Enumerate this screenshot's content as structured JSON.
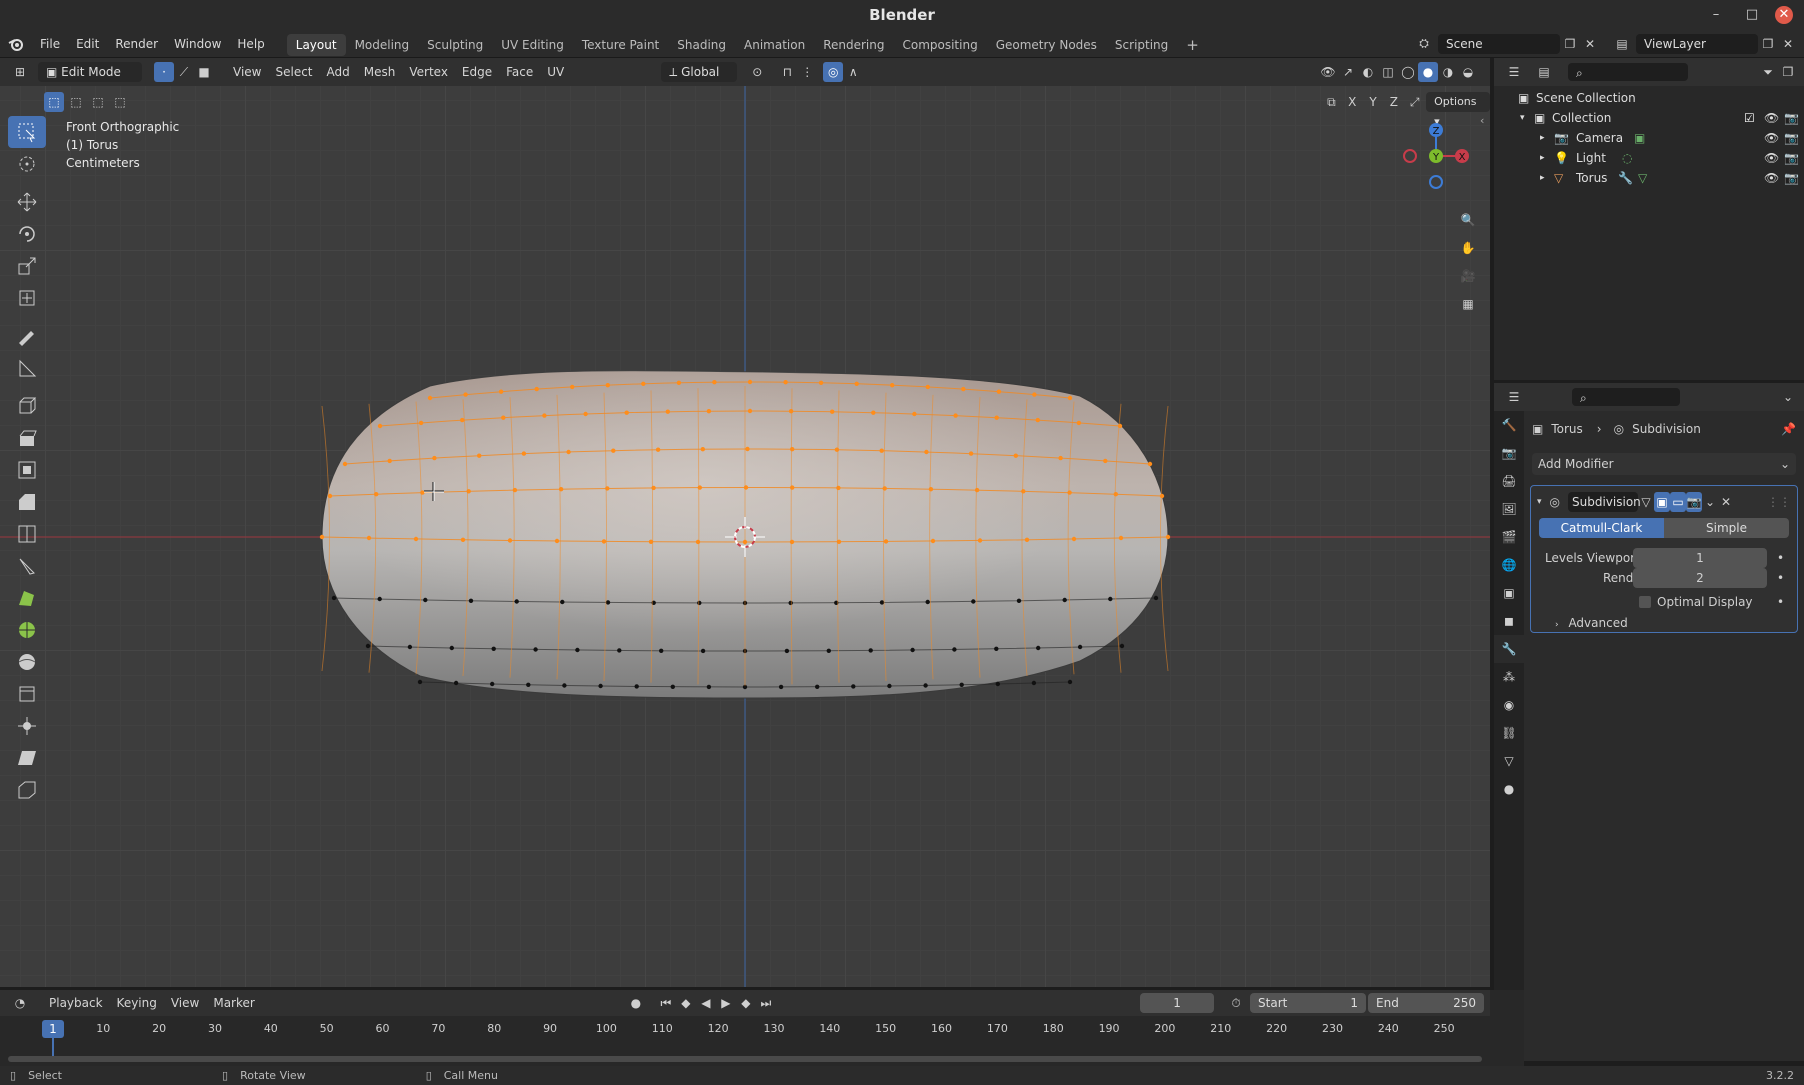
{
  "window": {
    "title": "Blender",
    "minimize": "–",
    "maximize": "□",
    "close": "✕"
  },
  "menubar": {
    "items": [
      "File",
      "Edit",
      "Render",
      "Window",
      "Help"
    ],
    "workspaces": [
      "Layout",
      "Modeling",
      "Sculpting",
      "UV Editing",
      "Texture Paint",
      "Shading",
      "Animation",
      "Rendering",
      "Compositing",
      "Geometry Nodes",
      "Scripting"
    ],
    "active_workspace": "Layout",
    "add_tab": "+",
    "scene": "Scene",
    "view_layer": "ViewLayer"
  },
  "viewport_header": {
    "mode": "Edit Mode",
    "menus": [
      "View",
      "Select",
      "Add",
      "Mesh",
      "Vertex",
      "Edge",
      "Face",
      "UV"
    ],
    "transform_orientation": "Global",
    "options": "Options",
    "axes": [
      "X",
      "Y",
      "Z"
    ]
  },
  "viewport": {
    "view_name": "Front Orthographic",
    "object_label": "(1) Torus",
    "units": "Centimeters",
    "gizmo": {
      "z": "Z",
      "y": "Y",
      "x": "X"
    }
  },
  "outliner": {
    "scene_collection": "Scene Collection",
    "collection": "Collection",
    "items": [
      "Camera",
      "Light",
      "Torus"
    ]
  },
  "properties": {
    "breadcrumb_object": "Torus",
    "breadcrumb_modifier": "Subdivision",
    "add_modifier": "Add Modifier",
    "modifier_name": "Subdivision",
    "type_catmull": "Catmull-Clark",
    "type_simple": "Simple",
    "levels_viewport_label": "Levels Viewport",
    "levels_viewport_value": "1",
    "render_label": "Render",
    "render_value": "2",
    "optimal_display": "Optimal Display",
    "advanced": "Advanced"
  },
  "timeline": {
    "menus": [
      "Playback",
      "Keying",
      "View",
      "Marker"
    ],
    "current_frame": "1",
    "start_label": "Start",
    "start_value": "1",
    "end_label": "End",
    "end_value": "250",
    "ticks": [
      "10",
      "20",
      "30",
      "40",
      "50",
      "60",
      "70",
      "80",
      "90",
      "100",
      "110",
      "120",
      "130",
      "140",
      "150",
      "160",
      "170",
      "180",
      "190",
      "200",
      "210",
      "220",
      "230",
      "240",
      "250"
    ],
    "playhead": "1"
  },
  "statusbar": {
    "select": "Select",
    "rotate": "Rotate View",
    "call_menu": "Call Menu",
    "version": "3.2.2"
  },
  "colors": {
    "accent": "#4772b3",
    "selected_edge": "#f08a24",
    "x_axis": "#c73c4a",
    "y_axis": "#7dbb2c",
    "z_axis": "#3d7cd6"
  }
}
